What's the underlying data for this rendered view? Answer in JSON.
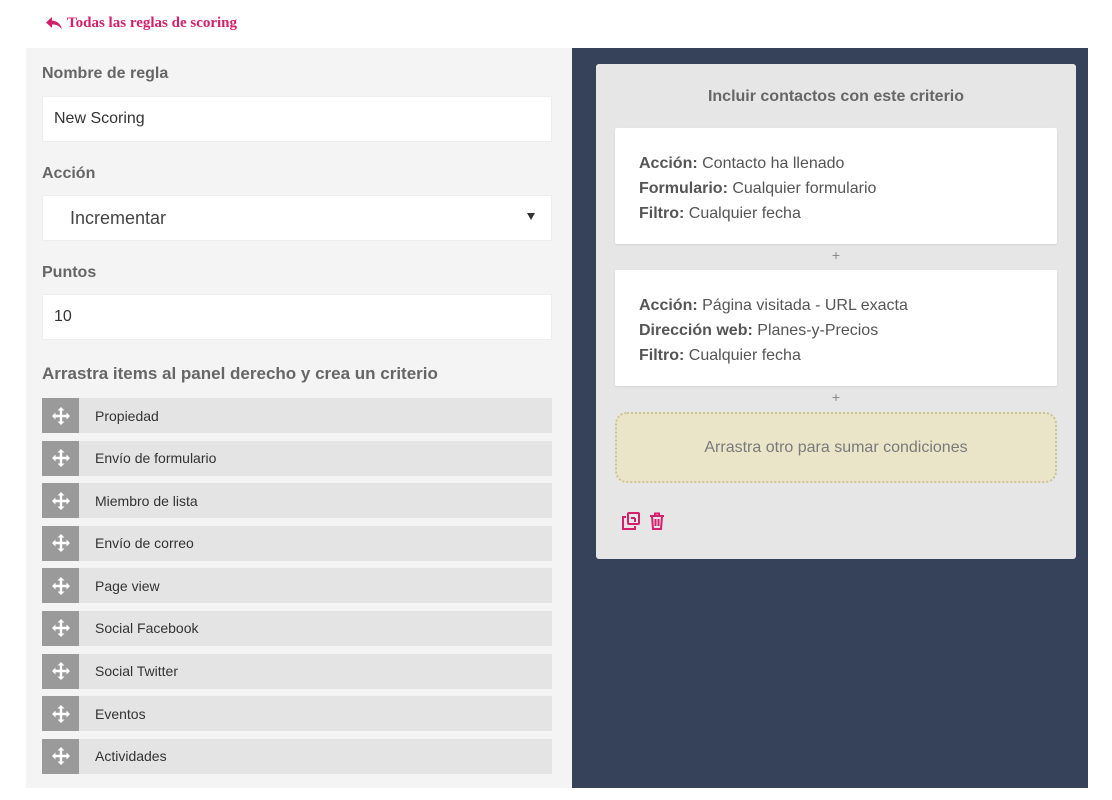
{
  "back_link": {
    "label": "Todas las reglas de scoring"
  },
  "form": {
    "rule_name_label": "Nombre de regla",
    "rule_name_value": "New Scoring",
    "action_label": "Acción",
    "action_value": "Incrementar",
    "points_label": "Puntos",
    "points_value": "10"
  },
  "drag_panel": {
    "heading": "Arrastra items al panel derecho y crea un criterio",
    "items": [
      {
        "label": "Propiedad"
      },
      {
        "label": "Envío de formulario"
      },
      {
        "label": "Miembro de lista"
      },
      {
        "label": "Envío de correo"
      },
      {
        "label": "Page view"
      },
      {
        "label": "Social Facebook"
      },
      {
        "label": "Social Twitter"
      },
      {
        "label": "Eventos"
      },
      {
        "label": "Actividades"
      }
    ]
  },
  "criteria": {
    "title": "Incluir contactos con este criterio",
    "conditions": [
      {
        "lines": [
          {
            "key": "Acción:",
            "value": "Contacto ha llenado"
          },
          {
            "key": "Formulario:",
            "value": "Cualquier formulario"
          },
          {
            "key": "Filtro:",
            "value": "Cualquier fecha"
          }
        ]
      },
      {
        "lines": [
          {
            "key": "Acción:",
            "value": "Página visitada - URL exacta"
          },
          {
            "key": "Dirección web:",
            "value": "Planes-y-Precios"
          },
          {
            "key": "Filtro:",
            "value": "Cualquier fecha"
          }
        ]
      }
    ],
    "plus_symbol": "+",
    "drop_zone_text": "Arrastra otro para sumar condiciones"
  },
  "colors": {
    "accent": "#d4206c",
    "right_panel_bg": "#364259",
    "left_panel_bg": "#f4f4f4",
    "drop_zone_bg": "#eae5c8"
  },
  "icons": {
    "back": "reply-arrow-icon",
    "drag": "move-arrows-icon",
    "copy": "copy-icon",
    "delete": "trash-icon"
  }
}
